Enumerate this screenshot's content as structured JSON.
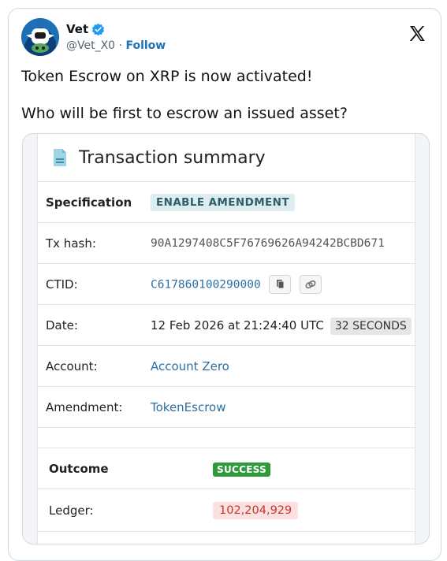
{
  "author": {
    "name": "Vet",
    "handle": "@Vet_X0",
    "separator": "·",
    "follow_label": "Follow"
  },
  "tweet": {
    "line1": "Token Escrow on XRP is now activated!",
    "line2": "Who will be first to escrow an issued asset?"
  },
  "summary": {
    "title": "Transaction summary",
    "rows": {
      "specification": {
        "label": "Specification",
        "value": "ENABLE AMENDMENT"
      },
      "tx_hash": {
        "label": "Tx hash:",
        "value": "90A1297408C5F76769626A94242BCBD671"
      },
      "ctid": {
        "label": "CTID:",
        "value": "C617860100290000"
      },
      "date": {
        "label": "Date:",
        "value": "12 Feb 2026 at 21:24:40 UTC",
        "ago": "32 SECONDS"
      },
      "account": {
        "label": "Account:",
        "value": "Account Zero"
      },
      "amendment": {
        "label": "Amendment:",
        "value": "TokenEscrow"
      }
    },
    "outcome": {
      "label": "Outcome",
      "status": "SUCCESS"
    },
    "ledger": {
      "label": "Ledger:",
      "value": "102,204,929"
    }
  },
  "colors": {
    "verified": "#1d9bf0",
    "link": "#2c6fa3",
    "success": "#2f9a3a",
    "ledger_text": "#c0392b"
  }
}
